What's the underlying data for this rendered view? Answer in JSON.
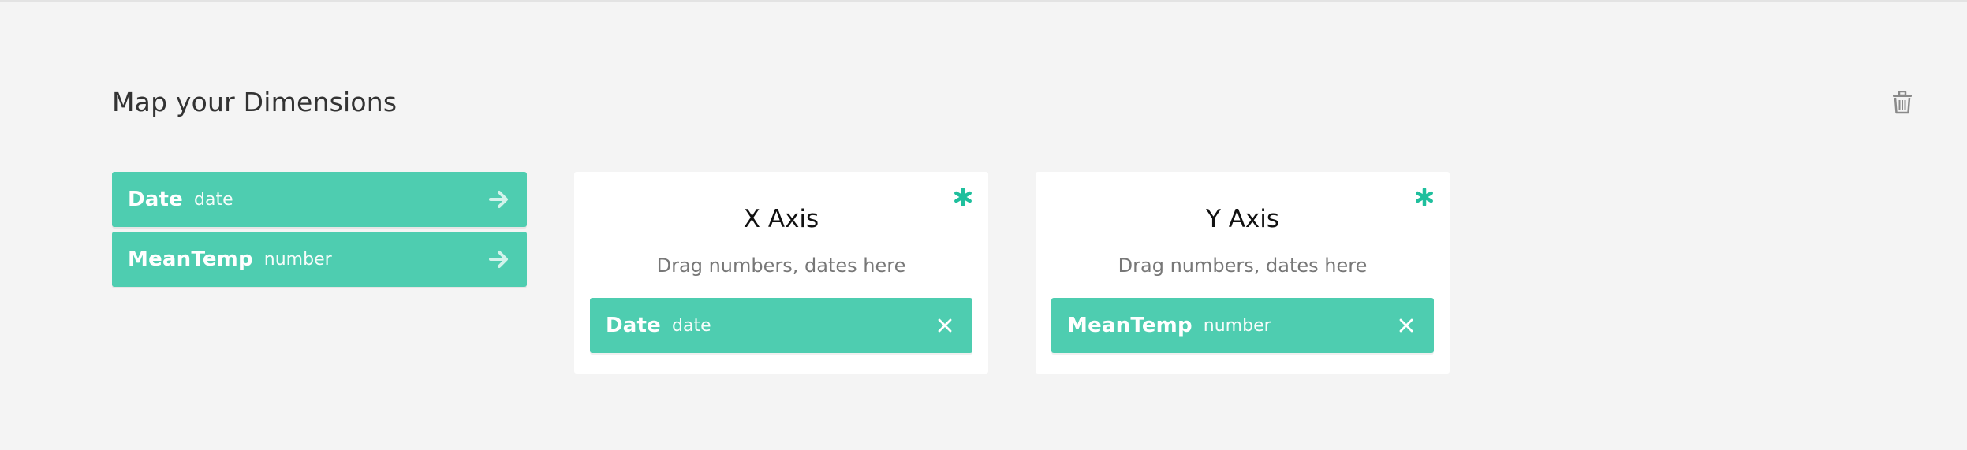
{
  "header": {
    "title": "Map your Dimensions"
  },
  "dimensions": [
    {
      "name": "Date",
      "type": "date"
    },
    {
      "name": "MeanTemp",
      "type": "number"
    }
  ],
  "axes": [
    {
      "title": "X Axis",
      "hint": "Drag numbers, dates here",
      "assigned": {
        "name": "Date",
        "type": "date"
      }
    },
    {
      "title": "Y Axis",
      "hint": "Drag numbers, dates here",
      "assigned": {
        "name": "MeanTemp",
        "type": "number"
      }
    }
  ],
  "icons": {
    "delete": "trash-icon",
    "add": "arrow-right-icon",
    "remove": "close-icon",
    "required": "asterisk-icon"
  },
  "colors": {
    "background": "#f4f4f4",
    "pill": "#4ecdb0",
    "accent": "#1fbf9d",
    "card": "#ffffff"
  }
}
